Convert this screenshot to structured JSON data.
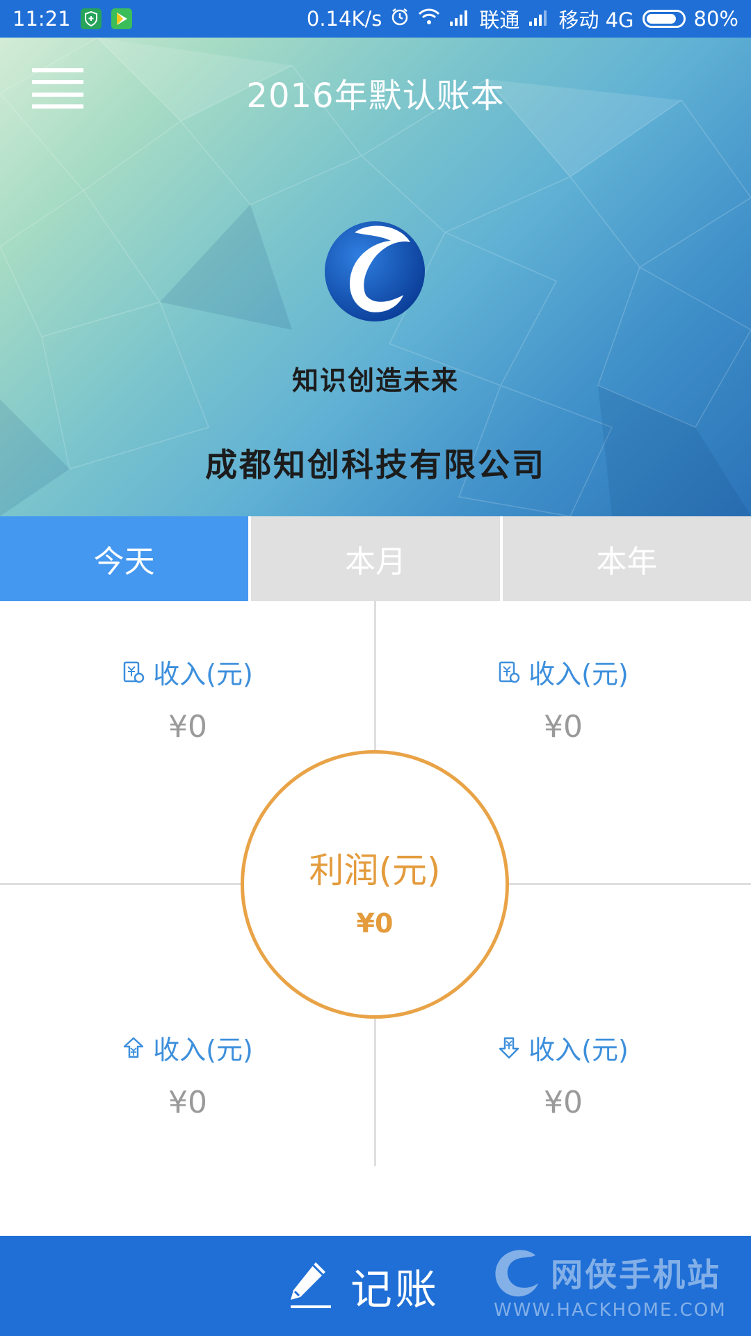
{
  "status_bar": {
    "time": "11:21",
    "network_speed": "0.14K/s",
    "carrier_1": "联通",
    "carrier_2": "移动 4G",
    "battery": "80%",
    "icons": [
      "shield-icon",
      "play-store-icon",
      "alarm-icon",
      "wifi-icon",
      "signal-icon",
      "battery-icon"
    ]
  },
  "header": {
    "title": "2016年默认账本",
    "menu_icon": "menu-icon",
    "logo_icon": "company-logo",
    "slogan": "知识创造未来",
    "company": "成都知创科技有限公司"
  },
  "tabs": [
    {
      "label": "今天",
      "active": true
    },
    {
      "label": "本月",
      "active": false
    },
    {
      "label": "本年",
      "active": false
    }
  ],
  "stats": {
    "top_left": {
      "label": "收入(元)",
      "value": "¥0",
      "icon": "bill-icon"
    },
    "top_right": {
      "label": "收入(元)",
      "value": "¥0",
      "icon": "bill-icon"
    },
    "bottom_left": {
      "label": "收入(元)",
      "value": "¥0",
      "icon": "upload-money-icon"
    },
    "bottom_right": {
      "label": "收入(元)",
      "value": "¥0",
      "icon": "download-money-icon"
    },
    "profit": {
      "label": "利润(元)",
      "value": "¥0"
    }
  },
  "bottom_bar": {
    "record_label": "记账",
    "record_icon": "pencil-icon",
    "watermark_name": "网侠手机站",
    "watermark_url": "WWW.HACKHOME.COM"
  },
  "colors": {
    "primary": "#1f6fd6",
    "tab_active": "#4598f0",
    "tab_inactive": "#e0e0e0",
    "stat_label": "#3d8fdc",
    "profit": "#e39b3c"
  }
}
